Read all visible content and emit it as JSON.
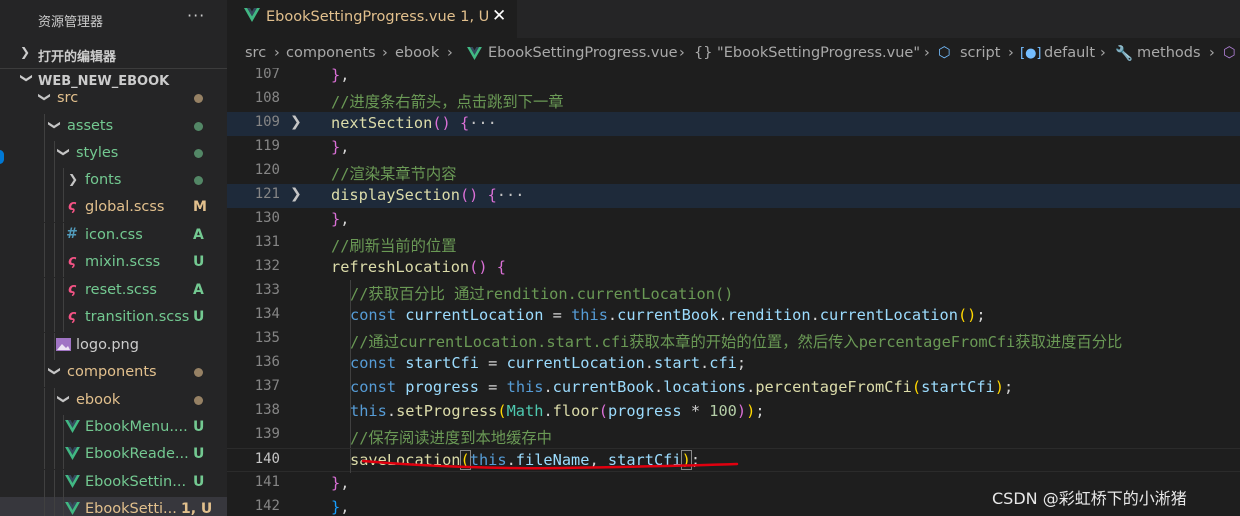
{
  "sidebar": {
    "title": "资源管理器",
    "more": "···",
    "open_editors": "打开的编辑器",
    "project": "WEB_NEW_EBOOK",
    "tree": [
      {
        "name": "src",
        "status": "",
        "color": "#e2c08d"
      },
      {
        "name": "assets",
        "status": "",
        "color": "#73c991"
      },
      {
        "name": "styles",
        "status": "",
        "color": "#73c991"
      },
      {
        "name": "fonts",
        "status": "",
        "color": "#73c991"
      },
      {
        "name": "global.scss",
        "status": "M",
        "color": "#e2c08d"
      },
      {
        "name": "icon.css",
        "status": "A",
        "color": "#73c991"
      },
      {
        "name": "mixin.scss",
        "status": "U",
        "color": "#73c991"
      },
      {
        "name": "reset.scss",
        "status": "A",
        "color": "#73c991"
      },
      {
        "name": "transition.scss",
        "status": "U",
        "color": "#73c991"
      },
      {
        "name": "logo.png",
        "status": "",
        "color": "#cccccc"
      },
      {
        "name": "components",
        "status": "",
        "color": "#e2c08d"
      },
      {
        "name": "ebook",
        "status": "",
        "color": "#e2c08d"
      },
      {
        "name": "EbookMenu....",
        "status": "U",
        "color": "#73c991"
      },
      {
        "name": "EbookReade...",
        "status": "U",
        "color": "#73c991"
      },
      {
        "name": "EbookSettin...",
        "status": "U",
        "color": "#73c991"
      },
      {
        "name": "EbookSetti...",
        "status": "1, U",
        "color": "#e2c08d"
      }
    ]
  },
  "tab": {
    "name": "EbookSettingProgress.vue",
    "status": "1, U",
    "close": "✕"
  },
  "breadcrumbs": [
    "src",
    "components",
    "ebook",
    "EbookSettingProgress.vue",
    "{} \"EbookSettingProgress.vue\"",
    "script",
    "default",
    "methods"
  ],
  "editor": {
    "line_numbers": [
      "107",
      "108",
      "109",
      "119",
      "120",
      "121",
      "130",
      "131",
      "132",
      "133",
      "134",
      "135",
      "136",
      "137",
      "138",
      "139",
      "140",
      "141",
      "142"
    ],
    "current_line": "140",
    "comments": {
      "c108": "//进度条右箭头，点击跳到下一章",
      "c120": "//渲染某章节内容",
      "c131": "//刷新当前的位置",
      "c133": "//获取百分比 通过rendition.currentLocation()",
      "c135": "//通过currentLocation.start.cfi获取本章的开始的位置，然后传入percentageFromCfi获取进度百分比",
      "c139": "//保存阅读进度到本地缓存中"
    },
    "tokens": {
      "nextSection": "nextSection",
      "displaySection": "displaySection",
      "refreshLocation": "refreshLocation",
      "const": "const",
      "currentLocation": "currentLocation",
      "this": "this",
      "currentBook": "currentBook",
      "rendition": "rendition",
      "startCfi": "startCfi",
      "start": "start",
      "cfi": "cfi",
      "progress": "progress",
      "locations": "locations",
      "percentageFromCfi": "percentageFromCfi",
      "setProgress": "setProgress",
      "Math": "Math",
      "floor": "floor",
      "hundred": "100",
      "saveLocation": "saveLocation",
      "fileName": "fileName",
      "ellipsis": "···"
    }
  },
  "watermark": "CSDN @彩虹桥下的小淅猪",
  "colors": {
    "underline": "#e0000f",
    "modified": "#e2c08d",
    "untracked": "#73c991",
    "vue": "#41b883",
    "scss": "#f55385"
  }
}
